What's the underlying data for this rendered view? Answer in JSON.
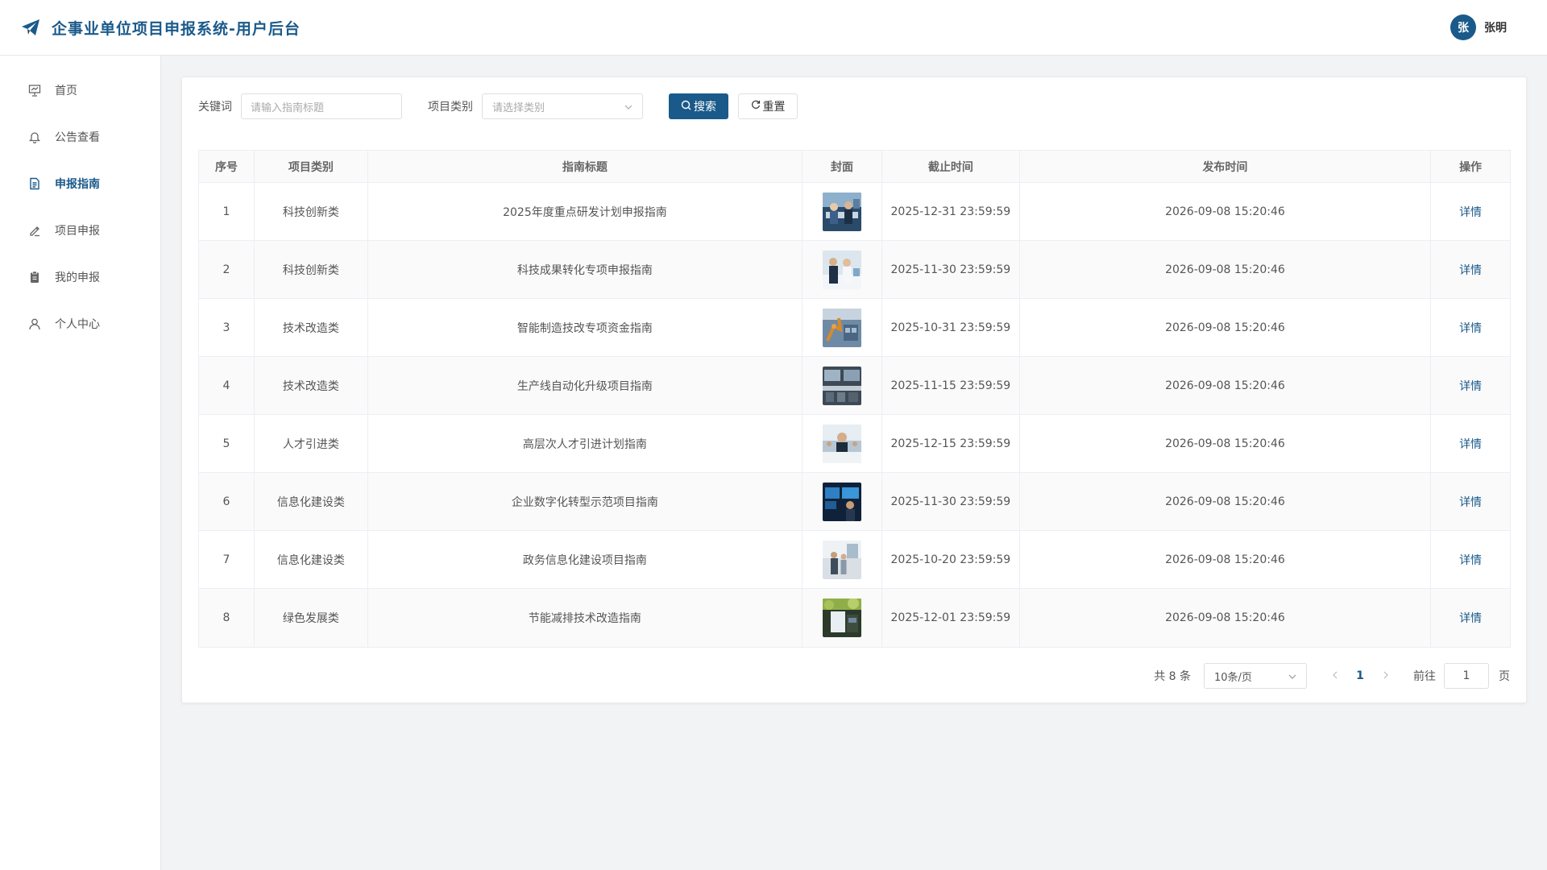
{
  "header": {
    "title": "企事业单位项目申报系统-用户后台",
    "brand_icon": "paper-plane-icon",
    "user": {
      "avatar_text": "张",
      "name": "张明"
    }
  },
  "sidebar": {
    "items": [
      {
        "label": "首页",
        "icon": "chart-board-icon",
        "active": false
      },
      {
        "label": "公告查看",
        "icon": "bell-icon",
        "active": false
      },
      {
        "label": "申报指南",
        "icon": "document-icon",
        "active": true
      },
      {
        "label": "项目申报",
        "icon": "pen-icon",
        "active": false
      },
      {
        "label": "我的申报",
        "icon": "clipboard-icon",
        "active": false
      },
      {
        "label": "个人中心",
        "icon": "user-icon",
        "active": false
      }
    ]
  },
  "filter": {
    "keyword_label": "关键词",
    "keyword_placeholder": "请输入指南标题",
    "category_label": "项目类别",
    "category_placeholder": "请选择类别",
    "search_label": "搜索",
    "reset_label": "重置"
  },
  "table": {
    "headers": [
      "序号",
      "项目类别",
      "指南标题",
      "封面",
      "截止时间",
      "发布时间",
      "操作"
    ],
    "rows": [
      {
        "index": "1",
        "category": "科技创新类",
        "title": "2025年度重点研发计划申报指南",
        "deadline": "2025-12-31 23:59:59",
        "published": "2026-09-08 15:20:46",
        "action": "详情"
      },
      {
        "index": "2",
        "category": "科技创新类",
        "title": "科技成果转化专项申报指南",
        "deadline": "2025-11-30 23:59:59",
        "published": "2026-09-08 15:20:46",
        "action": "详情"
      },
      {
        "index": "3",
        "category": "技术改造类",
        "title": "智能制造技改专项资金指南",
        "deadline": "2025-10-31 23:59:59",
        "published": "2026-09-08 15:20:46",
        "action": "详情"
      },
      {
        "index": "4",
        "category": "技术改造类",
        "title": "生产线自动化升级项目指南",
        "deadline": "2025-11-15 23:59:59",
        "published": "2026-09-08 15:20:46",
        "action": "详情"
      },
      {
        "index": "5",
        "category": "人才引进类",
        "title": "高层次人才引进计划指南",
        "deadline": "2025-12-15 23:59:59",
        "published": "2026-09-08 15:20:46",
        "action": "详情"
      },
      {
        "index": "6",
        "category": "信息化建设类",
        "title": "企业数字化转型示范项目指南",
        "deadline": "2025-11-30 23:59:59",
        "published": "2026-09-08 15:20:46",
        "action": "详情"
      },
      {
        "index": "7",
        "category": "信息化建设类",
        "title": "政务信息化建设项目指南",
        "deadline": "2025-10-20 23:59:59",
        "published": "2026-09-08 15:20:46",
        "action": "详情"
      },
      {
        "index": "8",
        "category": "绿色发展类",
        "title": "节能减排技术改造指南",
        "deadline": "2025-12-01 23:59:59",
        "published": "2026-09-08 15:20:46",
        "action": "详情"
      }
    ]
  },
  "pagination": {
    "total_text": "共 8 条",
    "page_size": "10条/页",
    "current_page": "1",
    "goto_label": "前往",
    "goto_value": "1",
    "page_suffix": "页"
  },
  "colors": {
    "primary": "#1a5a8a",
    "border": "#ebeef5",
    "background": "#f2f3f5"
  }
}
